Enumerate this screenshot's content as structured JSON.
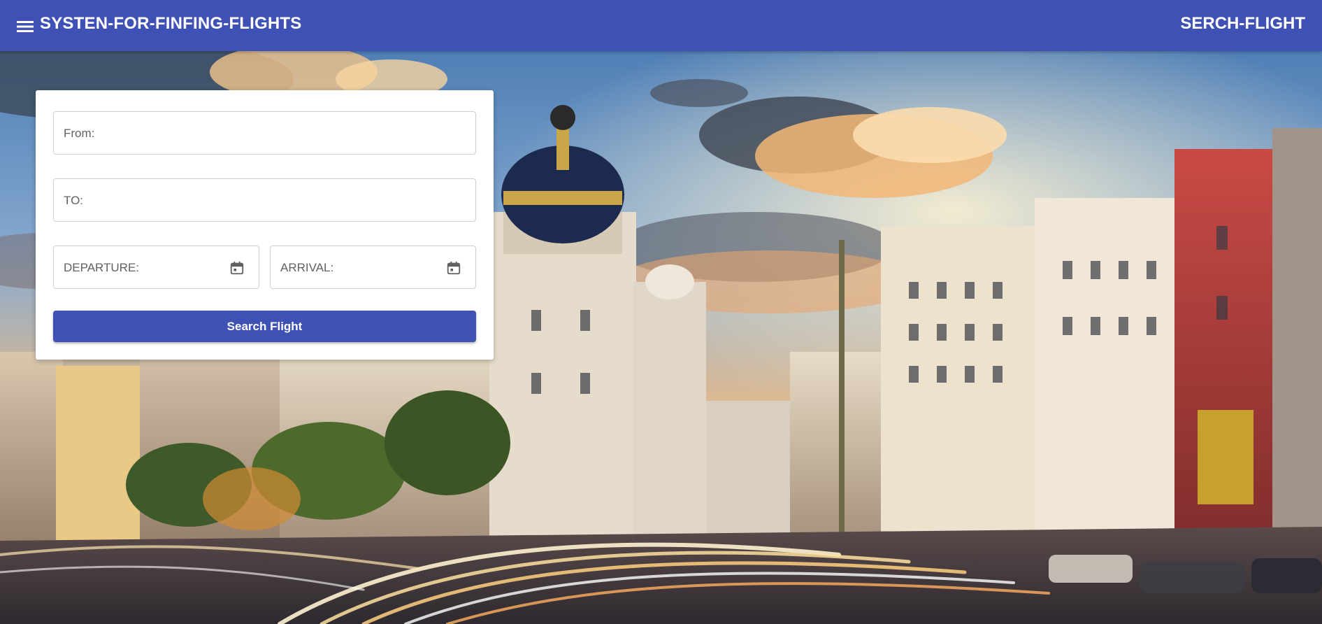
{
  "header": {
    "title": "SYSTEN-FOR-FINFING-FLIGHTS",
    "nav_link": "SERCH-FLIGHT",
    "menu_icon": "menu-icon",
    "background": "#3f51b5"
  },
  "search_form": {
    "from": {
      "placeholder": "From:",
      "value": ""
    },
    "to": {
      "placeholder": "TO:",
      "value": ""
    },
    "departure": {
      "placeholder": "DEPARTURE:",
      "value": "",
      "icon": "calendar-icon"
    },
    "arrival": {
      "placeholder": "ARRIVAL:",
      "value": "",
      "icon": "calendar-icon"
    },
    "submit_label": "Search Flight"
  },
  "colors": {
    "primary": "#3f51b5",
    "card": "#ffffff"
  }
}
